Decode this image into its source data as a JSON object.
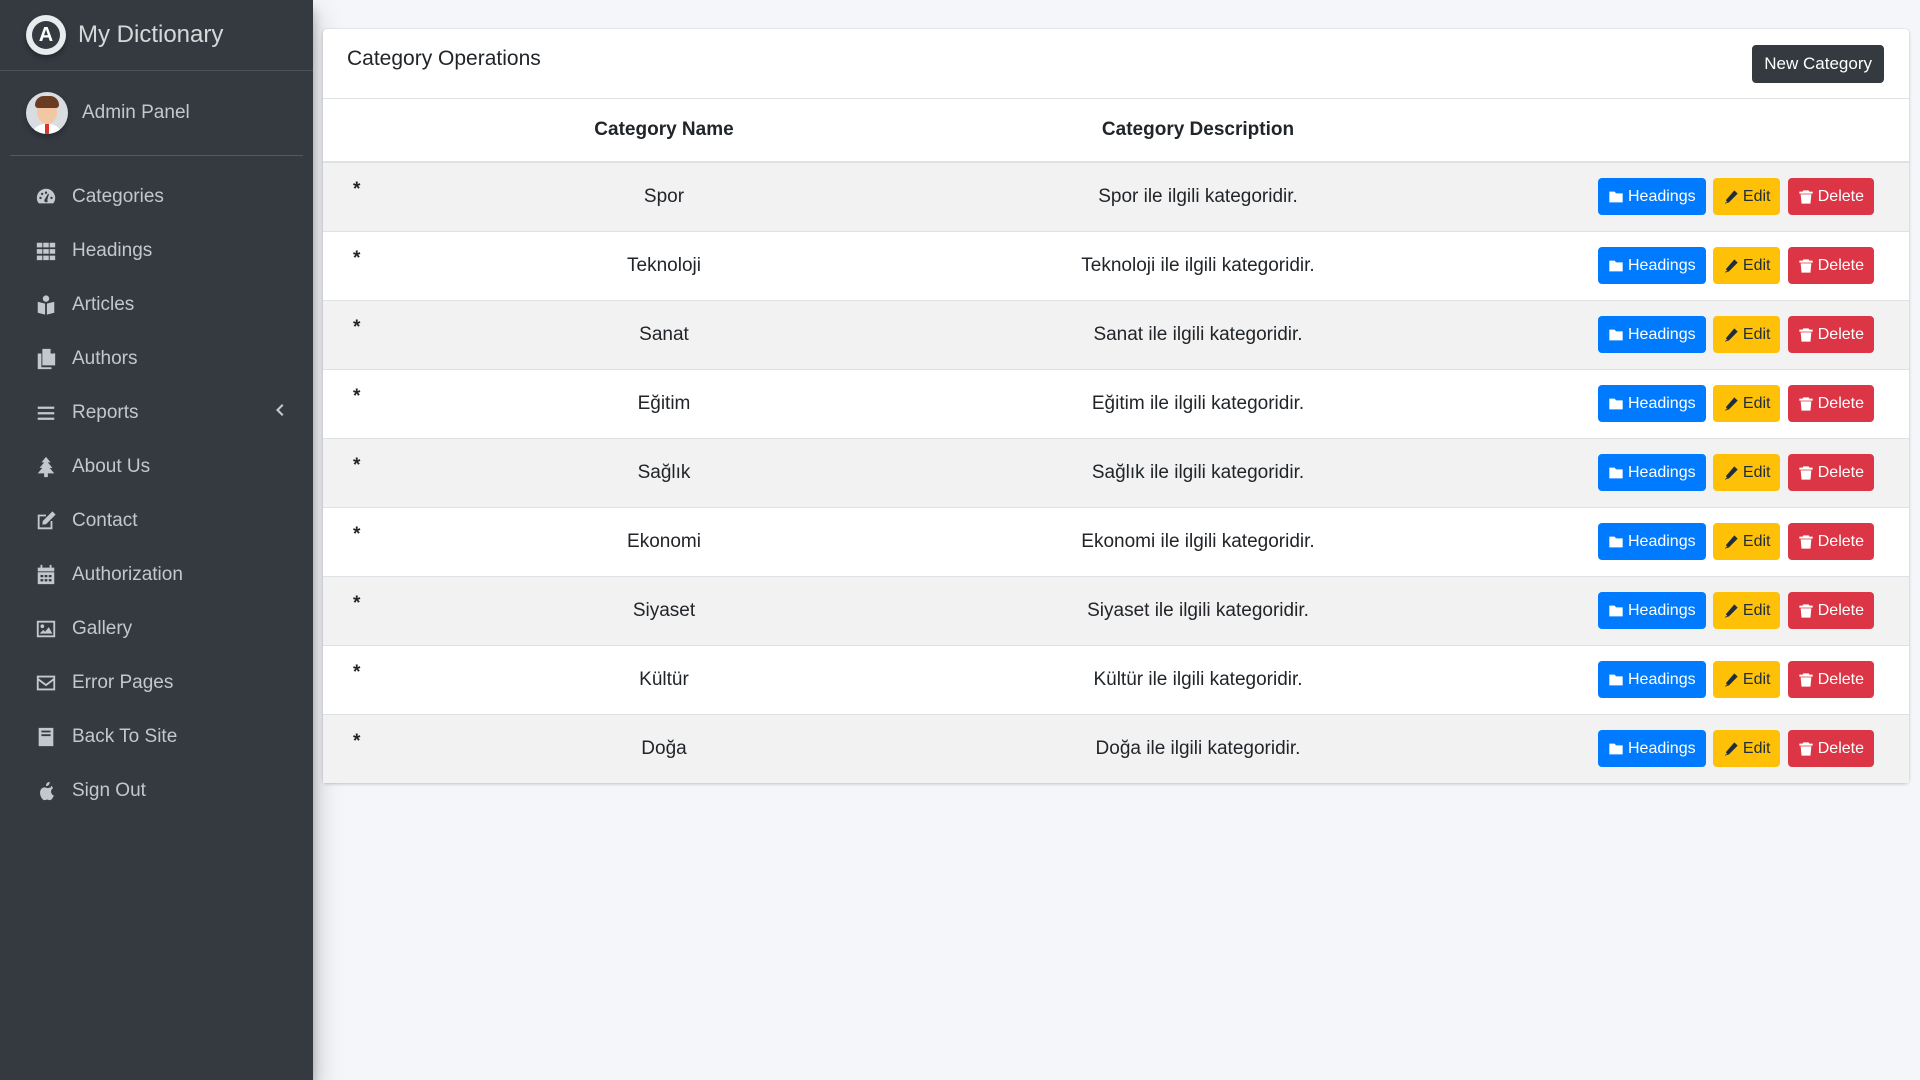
{
  "brand": {
    "title": "My Dictionary"
  },
  "user": {
    "name": "Admin Panel"
  },
  "sidebar": {
    "items": [
      {
        "label": "Categories",
        "icon": "tachometer-icon"
      },
      {
        "label": "Headings",
        "icon": "grid-icon"
      },
      {
        "label": "Articles",
        "icon": "book-reader-icon"
      },
      {
        "label": "Authors",
        "icon": "copy-icon"
      },
      {
        "label": "Reports",
        "icon": "bars-icon"
      },
      {
        "label": "About Us",
        "icon": "tree-icon"
      },
      {
        "label": "Contact",
        "icon": "edit-icon"
      },
      {
        "label": "Authorization",
        "icon": "calendar-icon"
      },
      {
        "label": "Gallery",
        "icon": "image-icon"
      },
      {
        "label": "Error Pages",
        "icon": "envelope-icon"
      },
      {
        "label": "Back To Site",
        "icon": "book-icon"
      },
      {
        "label": "Sign Out",
        "icon": "apple-icon"
      }
    ]
  },
  "card": {
    "title": "Category Operations",
    "new_button": "New Category"
  },
  "table": {
    "headers": {
      "name": "Category Name",
      "description": "Category Description"
    },
    "rows": [
      {
        "marker": "*",
        "name": "Spor",
        "description": "Spor ile ilgili kategoridir."
      },
      {
        "marker": "*",
        "name": "Teknoloji",
        "description": "Teknoloji ile ilgili kategoridir."
      },
      {
        "marker": "*",
        "name": "Sanat",
        "description": "Sanat ile ilgili kategoridir."
      },
      {
        "marker": "*",
        "name": "Eğitim",
        "description": "Eğitim ile ilgili kategoridir."
      },
      {
        "marker": "*",
        "name": "Sağlık",
        "description": "Sağlık ile ilgili kategoridir."
      },
      {
        "marker": "*",
        "name": "Ekonomi",
        "description": "Ekonomi ile ilgili kategoridir."
      },
      {
        "marker": "*",
        "name": "Siyaset",
        "description": "Siyaset ile ilgili kategoridir."
      },
      {
        "marker": "*",
        "name": "Kültür",
        "description": "Kültür ile ilgili kategoridir."
      },
      {
        "marker": "*",
        "name": "Doğa",
        "description": "Doğa ile ilgili kategoridir."
      }
    ],
    "actions": {
      "headings": "Headings",
      "edit": "Edit",
      "delete": "Delete"
    }
  },
  "colors": {
    "sidebar_bg": "#343a40",
    "primary": "#007bff",
    "warning": "#ffc107",
    "danger": "#dc3545"
  }
}
